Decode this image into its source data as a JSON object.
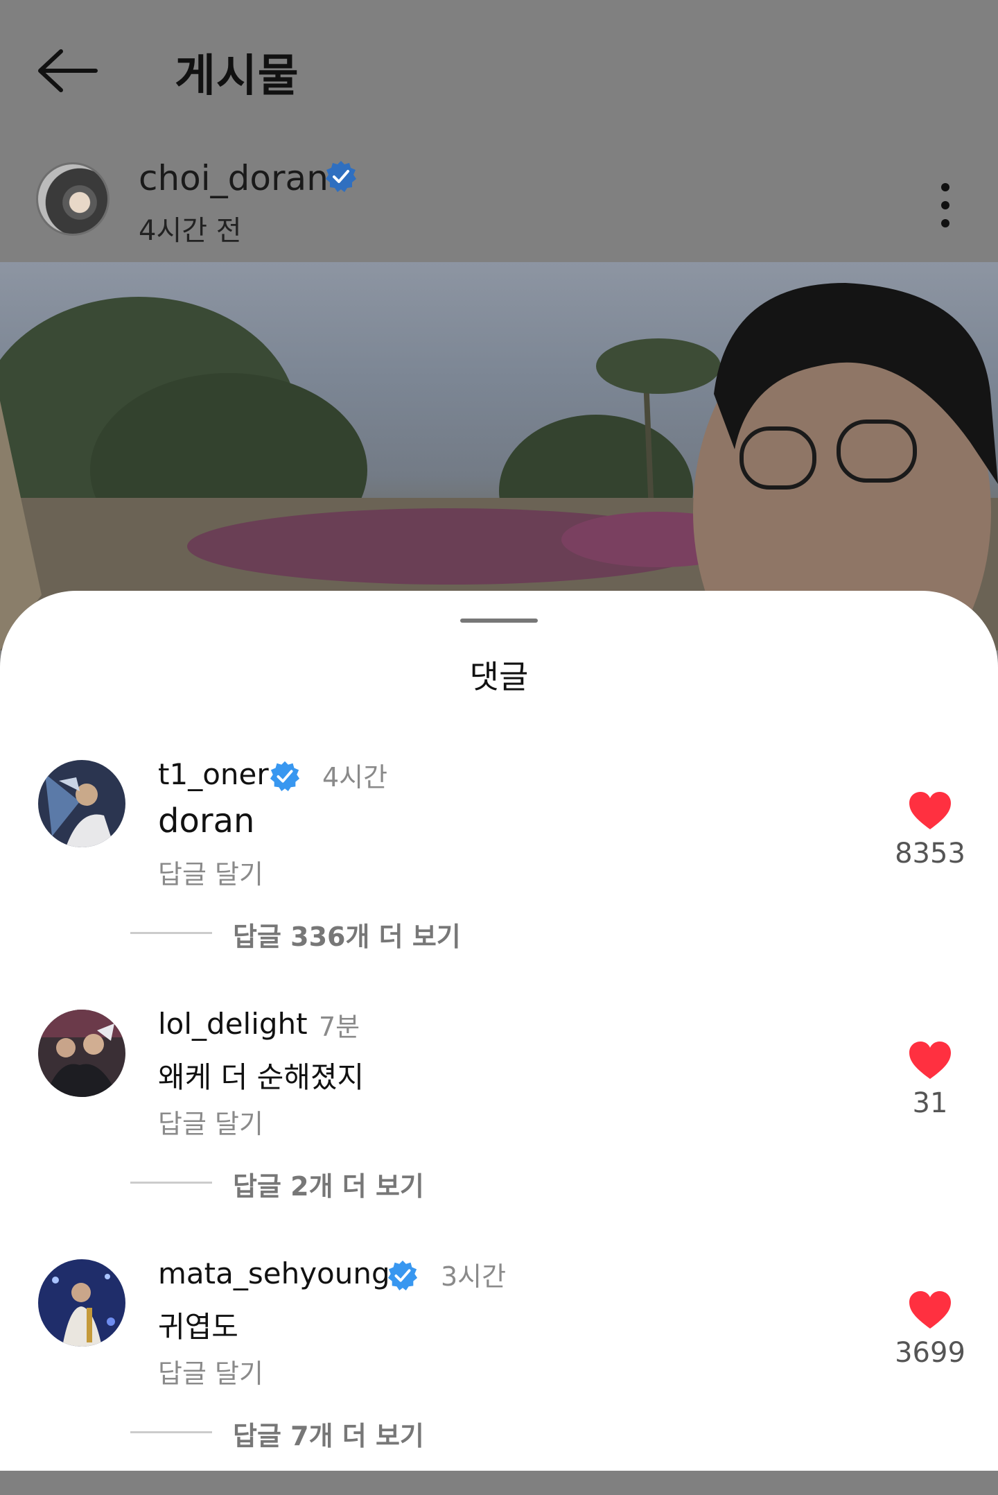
{
  "header": {
    "title": "게시물"
  },
  "post": {
    "author": "choi_doran",
    "time": "4시간 전"
  },
  "comments_sheet": {
    "title": "댓글",
    "comments": [
      {
        "user": "t1_oner",
        "verified": true,
        "time": "4시간",
        "text": "doran",
        "reply_label": "답글 달기",
        "likes": "8353",
        "more_replies": "답글 336개 더 보기"
      },
      {
        "user": "lol_delight",
        "verified": false,
        "time": "7분",
        "text": "왜케 더 순해졌지",
        "reply_label": "답글 달기",
        "likes": "31",
        "more_replies": "답글 2개 더 보기"
      },
      {
        "user": "mata_sehyoung",
        "verified": true,
        "time": "3시간",
        "text": "귀엽도",
        "reply_label": "답글 달기",
        "likes": "3699",
        "more_replies": "답글 7개 더 보기"
      }
    ]
  },
  "icons": {
    "back": "arrow-left-icon",
    "verified": "verified-badge-icon",
    "more": "more-vertical-icon",
    "like": "heart-icon"
  },
  "colors": {
    "verified_blue": "#3897f0",
    "heart_red": "#ff3040",
    "overlay_gray": "#808080"
  }
}
